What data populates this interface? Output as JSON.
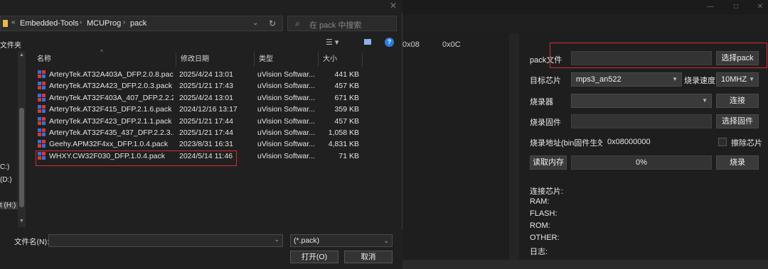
{
  "app": {
    "hex_columns": [
      "0x08",
      "0x0C"
    ],
    "pack_file": {
      "label": "pack文件",
      "value": "",
      "button": "选择pack"
    },
    "target_chip": {
      "label": "目标芯片",
      "value": "mps3_an522"
    },
    "burn_speed": {
      "label": "烧录速度",
      "value": "10MHZ"
    },
    "programmer": {
      "label": "烧录器",
      "value": "",
      "button": "连接"
    },
    "firmware": {
      "label": "烧录固件",
      "value": "",
      "button": "选择固件"
    },
    "burn_address": {
      "label": "烧录地址(bin固件生效)",
      "value": "0x08000000",
      "erase_label": "擦除芯片"
    },
    "read_memory": {
      "button": "读取内存",
      "progress_text": "0%",
      "progress": 0,
      "burn_button": "烧录"
    },
    "info_labels": [
      "连接芯片:",
      "RAM:",
      "FLASH:",
      "ROM:",
      "OTHER:",
      "日志:"
    ],
    "window_controls": [
      "—",
      "□",
      "✕"
    ]
  },
  "dialog": {
    "breadcrumb": [
      "Embedded-Tools",
      "MCUProg",
      "pack"
    ],
    "search_placeholder": "在 pack 中搜索",
    "nav_header": "文件夹",
    "nav_items": [
      "C:)",
      "(D:)",
      "t (H:)"
    ],
    "columns": {
      "name": "名称",
      "date": "修改日期",
      "type": "类型",
      "size": "大小"
    },
    "files": [
      {
        "name": "ArteryTek.AT32A403A_DFP.2.0.8.pack",
        "date": "2025/4/24 13:01",
        "type": "uVision Softwar...",
        "size": "441 KB"
      },
      {
        "name": "ArteryTek.AT32A423_DFP.2.0.3.pack",
        "date": "2025/1/21 17:43",
        "type": "uVision Softwar...",
        "size": "457 KB"
      },
      {
        "name": "ArteryTek.AT32F403A_407_DFP.2.2.2....",
        "date": "2025/4/24 13:01",
        "type": "uVision Softwar...",
        "size": "671 KB"
      },
      {
        "name": "ArteryTek.AT32F415_DFP.2.1.6.pack",
        "date": "2024/12/16 13:17",
        "type": "uVision Softwar...",
        "size": "359 KB"
      },
      {
        "name": "ArteryTek.AT32F423_DFP.2.1.1.pack",
        "date": "2025/1/21 17:44",
        "type": "uVision Softwar...",
        "size": "457 KB"
      },
      {
        "name": "ArteryTek.AT32F435_437_DFP.2.2.3....",
        "date": "2025/1/21 17:44",
        "type": "uVision Softwar...",
        "size": "1,058 KB"
      },
      {
        "name": "Geehy.APM32F4xx_DFP.1.0.4.pack",
        "date": "2023/8/31 16:31",
        "type": "uVision Softwar...",
        "size": "4,831 KB"
      },
      {
        "name": "WHXY.CW32F030_DFP.1.0.4.pack",
        "date": "2024/5/14 11:46",
        "type": "uVision Softwar...",
        "size": "71 KB"
      }
    ],
    "filename_label": "文件名(N):",
    "filename_value": "",
    "filter": "(*.pack)",
    "open_button": "打开(O)",
    "cancel_button": "取消"
  },
  "colors": {
    "highlight_box": "#d92b2b",
    "accent_blue": "#2f7de1",
    "pack_icon_blue": "#3b6fd8",
    "pack_icon_red": "#d33a3a"
  }
}
